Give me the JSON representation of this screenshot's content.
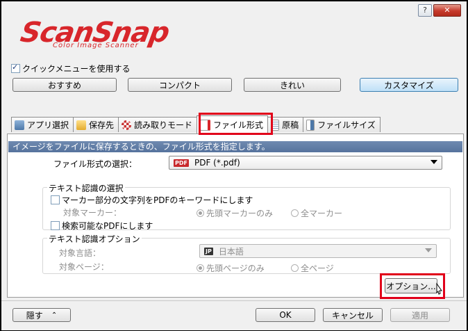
{
  "logo": {
    "brand": "ScanSnap",
    "tagline": "Color Image Scanner"
  },
  "quickmenu": {
    "label": "クイックメニューを使用する",
    "checked": true
  },
  "profiles": [
    {
      "label": "おすすめ"
    },
    {
      "label": "コンパクト"
    },
    {
      "label": "きれい"
    },
    {
      "label": "カスタマイズ",
      "selected": true
    }
  ],
  "tabs": [
    {
      "label": "アプリ選択",
      "icon": "app-icon"
    },
    {
      "label": "保存先",
      "icon": "folder-icon"
    },
    {
      "label": "読み取りモード",
      "icon": "scan-mode-icon"
    },
    {
      "label": "ファイル形式",
      "icon": "file-icon",
      "active": true
    },
    {
      "label": "原稿",
      "icon": "document-icon"
    },
    {
      "label": "ファイルサイズ",
      "icon": "file-size-icon"
    }
  ],
  "panel": {
    "description": "イメージをファイルに保存するときの、ファイル形式を指定します。",
    "format_label": "ファイル形式の選択：",
    "format_badge": "PDF",
    "format_value": "PDF (*.pdf)",
    "text_recog": {
      "title": "テキスト認識の選択",
      "marker_check": "マーカー部分の文字列をPDFのキーワードにします",
      "target_marker_label": "対象マーカー：",
      "radio_first_marker": "先頭マーカーのみ",
      "radio_all_markers": "全マーカー",
      "searchable_check": "検索可能なPDFにします"
    },
    "text_options": {
      "title": "テキスト認識オプション",
      "language_label": "対象言語：",
      "language_badge": "JP",
      "language_value": "日本語",
      "pages_label": "対象ページ：",
      "radio_first_page": "先頭ページのみ",
      "radio_all_pages": "全ページ"
    },
    "options_button": "オプション..."
  },
  "footer": {
    "hide_button": "隠す",
    "ok_button": "OK",
    "cancel_button": "キャンセル",
    "apply_button": "適用"
  },
  "colors": {
    "brand_red": "#d8262b",
    "highlight_red": "#e1001a",
    "description_bar": "#5f7ca6"
  }
}
